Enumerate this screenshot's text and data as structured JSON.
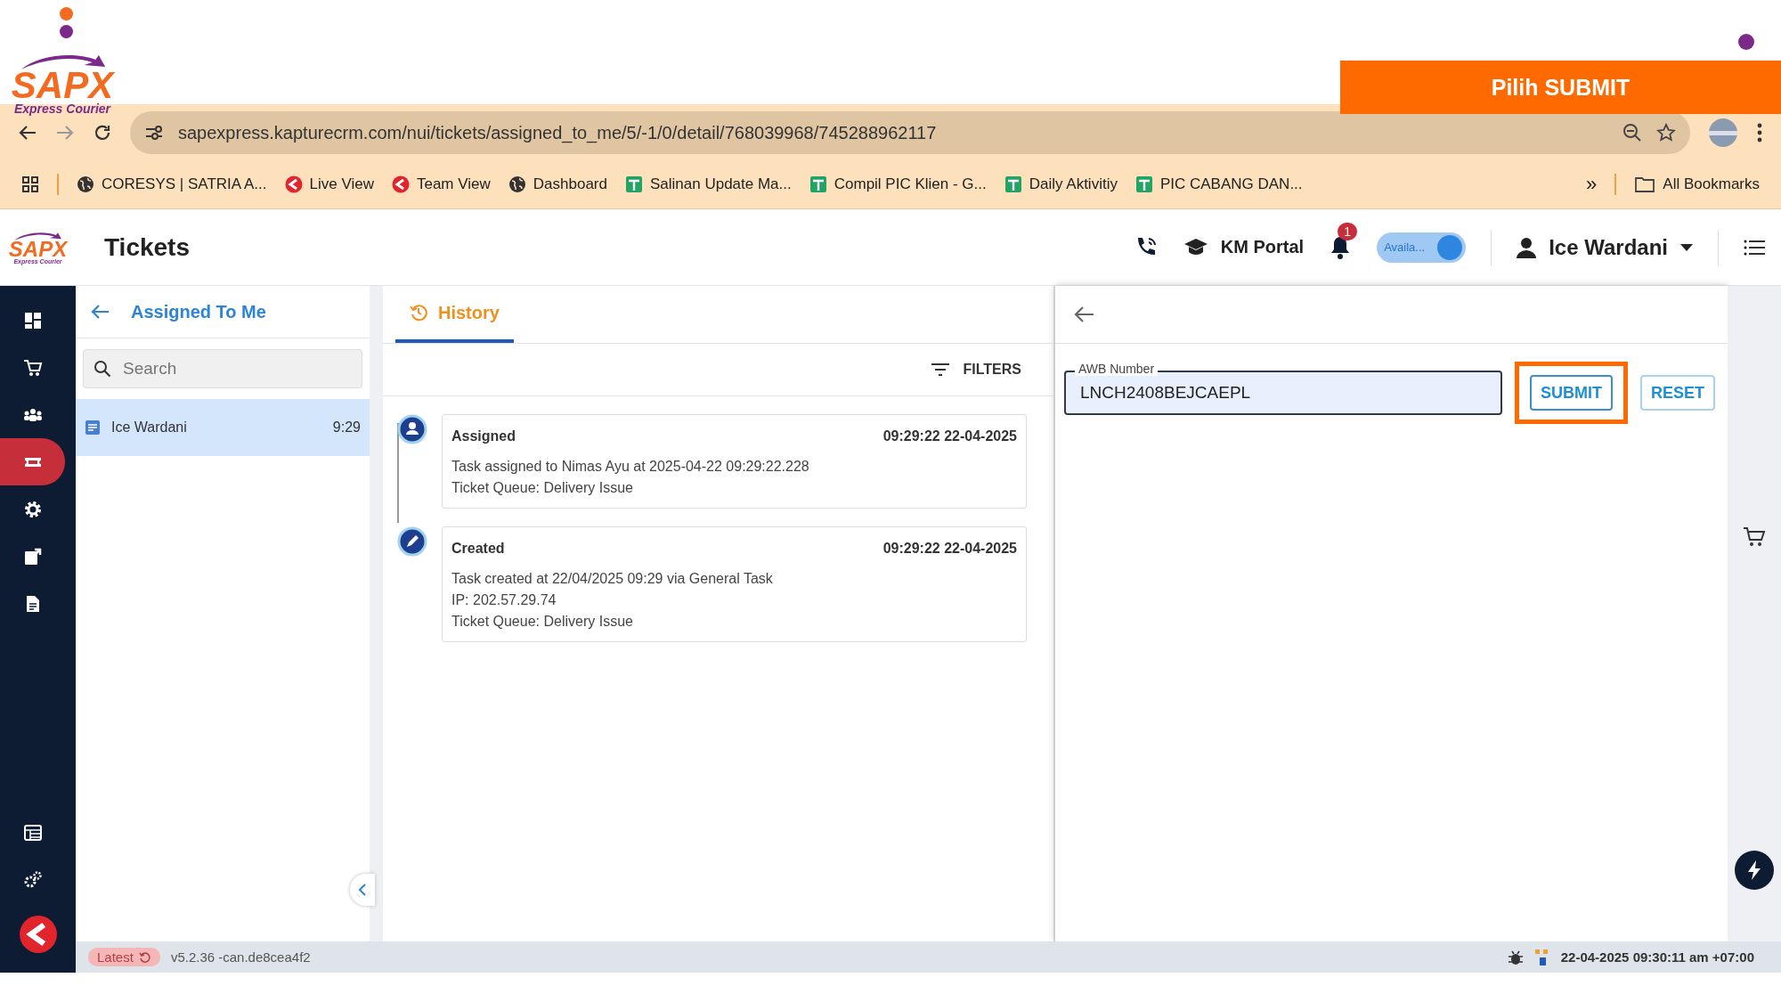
{
  "slide": {
    "logo": {
      "name": "SAPX",
      "tagline": "Express Courier"
    },
    "banner": "Pilih SUBMIT"
  },
  "browser": {
    "url": "sapexpress.kapturecrm.com/nui/tickets/assigned_to_me/5/-1/0/detail/768039968/745288962117",
    "bookmarks": [
      {
        "label": "CORESYS | SATRIA A...",
        "kind": "globe"
      },
      {
        "label": "Live View",
        "kind": "app"
      },
      {
        "label": "Team View",
        "kind": "app"
      },
      {
        "label": "Dashboard",
        "kind": "globe"
      },
      {
        "label": "Salinan Update Ma...",
        "kind": "sheet"
      },
      {
        "label": "Compil PIC Klien - G...",
        "kind": "sheet"
      },
      {
        "label": "Daily Aktivitiy",
        "kind": "sheet"
      },
      {
        "label": "PIC CABANG DAN...",
        "kind": "sheet"
      }
    ],
    "more": "»",
    "all_bookmarks": "All Bookmarks"
  },
  "header": {
    "logo": {
      "name": "SAPX",
      "tagline": "Express Courier"
    },
    "title": "Tickets",
    "km_portal": "KM Portal",
    "notification_count": "1",
    "availability": {
      "label": "Availa...",
      "on": true
    },
    "user": "Ice Wardani"
  },
  "nav": [
    {
      "kind": "dashboard",
      "selected": false
    },
    {
      "kind": "cart",
      "selected": false
    },
    {
      "kind": "team",
      "selected": false
    },
    {
      "kind": "ticket",
      "selected": true
    },
    {
      "kind": "settings",
      "selected": false
    },
    {
      "kind": "export",
      "selected": false
    },
    {
      "kind": "document",
      "selected": false
    }
  ],
  "nav_bottom": [
    {
      "kind": "table",
      "selected": false
    },
    {
      "kind": "gears",
      "selected": false
    }
  ],
  "list_panel": {
    "title": "Assigned To Me",
    "search_placeholder": "Search",
    "items": [
      {
        "name": "Ice Wardani",
        "time": "9:29",
        "selected": true
      }
    ]
  },
  "history": {
    "tab": "History",
    "filters": "FILTERS",
    "entries": [
      {
        "kind": "assigned",
        "title": "Assigned",
        "time": "09:29:22 22-04-2025",
        "lines": [
          "Task assigned to Nimas Ayu at 2025-04-22 09:29:22.228",
          "Ticket Queue: Delivery Issue"
        ]
      },
      {
        "kind": "created",
        "title": "Created",
        "time": "09:29:22 22-04-2025",
        "lines": [
          "Task created at 22/04/2025 09:29 via General Task",
          "IP: 202.57.29.74",
          "Ticket Queue: Delivery Issue"
        ]
      }
    ]
  },
  "form": {
    "field_label": "AWB Number",
    "value": "LNCH2408BEJCAEPL",
    "submit": {
      "label": "SUBMIT",
      "highlighted": true
    },
    "reset": "RESET"
  },
  "status_bar": {
    "badge": "Latest",
    "version": "v5.2.36 -can.de8cea4f2",
    "datetime": "22-04-2025 09:30:11 am +07:00"
  }
}
